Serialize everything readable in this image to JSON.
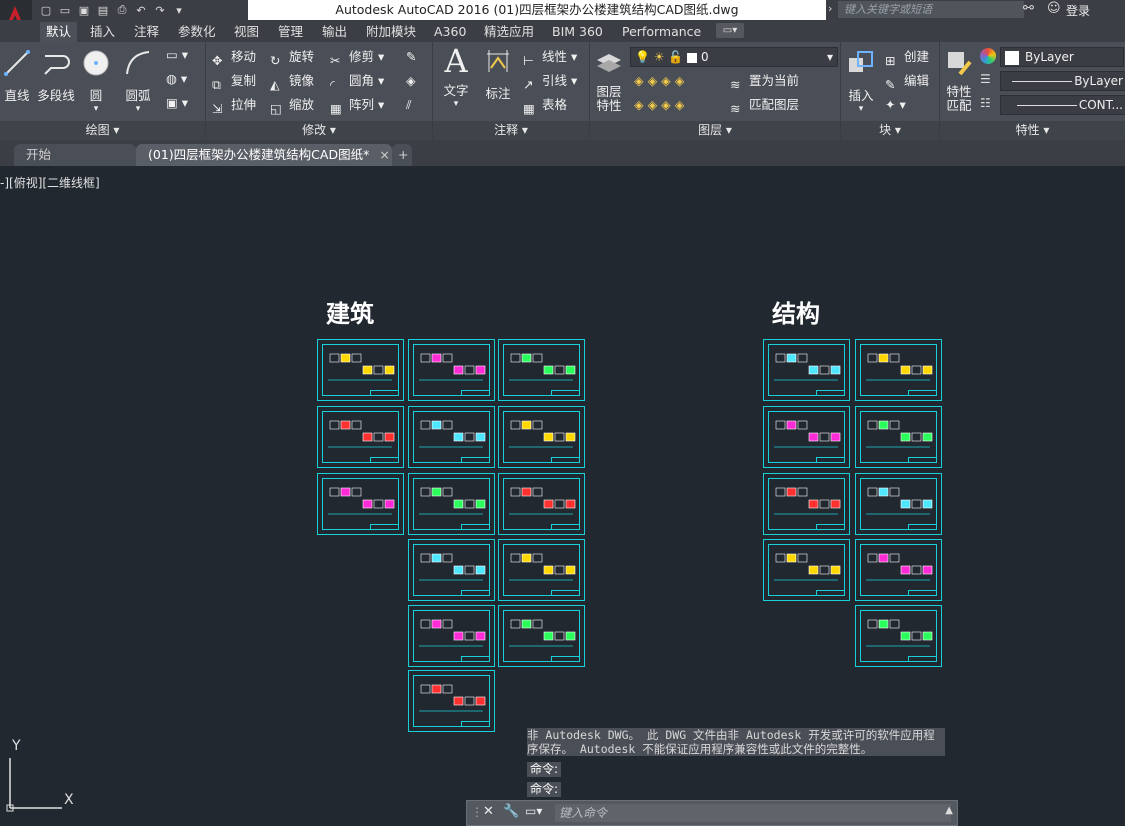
{
  "title_bar": {
    "title": "Autodesk AutoCAD 2016    (01)四层框架办公楼建筑结构CAD图纸.dwg",
    "search_placeholder": "键入关键字或短语",
    "login_label": "登录"
  },
  "ribbon_tabs": [
    "默认",
    "插入",
    "注释",
    "参数化",
    "视图",
    "管理",
    "输出",
    "附加模块",
    "A360",
    "精选应用",
    "BIM 360",
    "Performance"
  ],
  "panels": {
    "draw": {
      "title": "绘图",
      "buttons": [
        "直线",
        "多段线",
        "圆",
        "圆弧"
      ]
    },
    "modify": {
      "title": "修改",
      "buttons": [
        "移动",
        "旋转",
        "修剪",
        "复制",
        "镜像",
        "圆角",
        "拉伸",
        "缩放",
        "阵列"
      ]
    },
    "annotation": {
      "title": "注释",
      "buttons": [
        "文字",
        "标注",
        "线性",
        "引线",
        "表格"
      ]
    },
    "layers": {
      "title": "图层",
      "layer_properties": "图层特性",
      "current_layer": "0",
      "buttons": [
        "置为当前",
        "匹配图层"
      ]
    },
    "block": {
      "title": "块",
      "insert": "插入",
      "buttons": [
        "创建",
        "编辑"
      ]
    },
    "properties": {
      "title": "特性",
      "match": "特性匹配",
      "color": "ByLayer",
      "linetype": "ByLayer",
      "lineweight": "CONT..."
    }
  },
  "doc_tabs": {
    "start": "开始",
    "active": "(01)四层框架办公楼建筑结构CAD图纸*",
    "close": "×",
    "add": "+"
  },
  "canvas": {
    "view_label": "-][俯视][二维线框]",
    "heading_arch": "建筑",
    "heading_struct": "结构",
    "ucs_x": "X",
    "ucs_y": "Y"
  },
  "command": {
    "message": "非 Autodesk DWG。 此 DWG 文件由非 Autodesk 开发或许可的软件应用程序保存。 Autodesk 不能保证应用程序兼容性或此文件的完整性。",
    "line1": "命令:",
    "line2": "命令:",
    "placeholder": "键入命令"
  },
  "colors": {
    "sheet_border": "#18d0d8",
    "canvas_bg": "#212830"
  }
}
